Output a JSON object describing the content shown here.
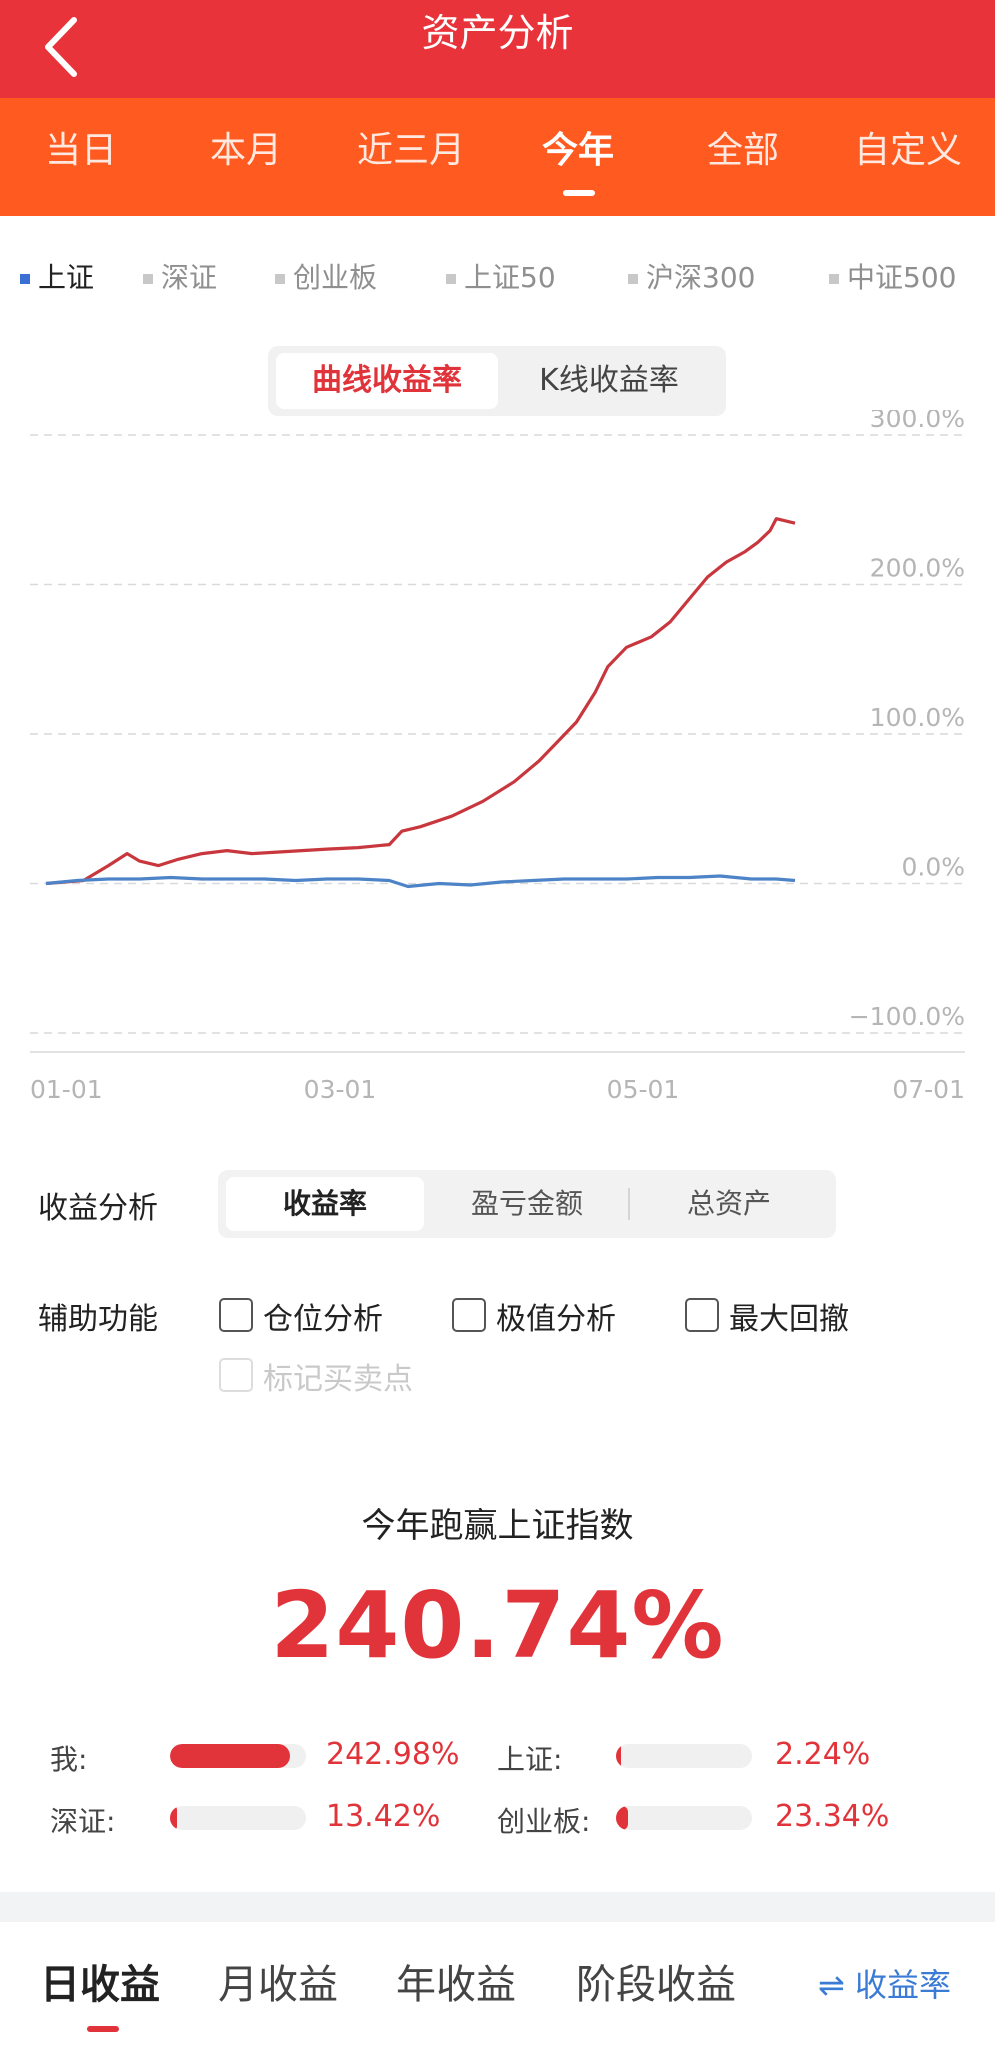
{
  "header": {
    "title": "资产分析",
    "bg": "#e8333a"
  },
  "period_tabs": {
    "items": [
      "当日",
      "本月",
      "近三月",
      "今年",
      "全部",
      "自定义"
    ],
    "active": "今年",
    "bg": "#ff5a1f"
  },
  "indices": {
    "items": [
      "上证",
      "深证",
      "创业板",
      "上证50",
      "沪深300",
      "中证500"
    ],
    "active": "上证"
  },
  "chart_toggle": {
    "curve": "曲线收益率",
    "kline": "K线收益率",
    "active": "曲线收益率"
  },
  "chart_data": {
    "type": "line",
    "ylim": [
      -100,
      300
    ],
    "y_ticks": [
      "300.0%",
      "200.0%",
      "100.0%",
      "0.0%",
      "−100.0%"
    ],
    "x_ticks": [
      "01-01",
      "03-01",
      "05-01",
      "07-01"
    ],
    "grid": "dashed horizontal",
    "series": [
      {
        "color": "#c8373d",
        "points": [
          [
            0,
            0
          ],
          [
            12,
            2
          ],
          [
            20,
            12
          ],
          [
            26,
            20
          ],
          [
            30,
            15
          ],
          [
            36,
            12
          ],
          [
            42,
            16
          ],
          [
            50,
            20
          ],
          [
            58,
            22
          ],
          [
            66,
            20
          ],
          [
            74,
            21
          ],
          [
            82,
            22
          ],
          [
            90,
            23
          ],
          [
            100,
            24
          ],
          [
            110,
            26
          ],
          [
            114,
            35
          ],
          [
            120,
            38
          ],
          [
            130,
            45
          ],
          [
            140,
            55
          ],
          [
            150,
            68
          ],
          [
            158,
            82
          ],
          [
            164,
            95
          ],
          [
            170,
            108
          ],
          [
            176,
            128
          ],
          [
            180,
            145
          ],
          [
            186,
            158
          ],
          [
            194,
            165
          ],
          [
            200,
            175
          ],
          [
            206,
            190
          ],
          [
            212,
            205
          ],
          [
            218,
            215
          ],
          [
            224,
            222
          ],
          [
            228,
            228
          ],
          [
            232,
            236
          ],
          [
            234,
            244
          ],
          [
            240,
            241
          ]
        ]
      },
      {
        "color": "#4d84c7",
        "points": [
          [
            0,
            0
          ],
          [
            10,
            2
          ],
          [
            20,
            3
          ],
          [
            30,
            3
          ],
          [
            40,
            4
          ],
          [
            50,
            3
          ],
          [
            60,
            3
          ],
          [
            70,
            3
          ],
          [
            80,
            2
          ],
          [
            90,
            3
          ],
          [
            100,
            3
          ],
          [
            110,
            2
          ],
          [
            116,
            -2
          ],
          [
            126,
            0
          ],
          [
            136,
            -1
          ],
          [
            146,
            1
          ],
          [
            156,
            2
          ],
          [
            166,
            3
          ],
          [
            176,
            3
          ],
          [
            186,
            3
          ],
          [
            196,
            4
          ],
          [
            206,
            4
          ],
          [
            216,
            5
          ],
          [
            226,
            3
          ],
          [
            234,
            3
          ],
          [
            240,
            2
          ]
        ]
      }
    ]
  },
  "analysis": {
    "label": "收益分析",
    "segments": [
      "收益率",
      "盈亏金额",
      "总资产"
    ],
    "active": "收益率"
  },
  "assist": {
    "label": "辅助功能",
    "options": [
      "仓位分析",
      "极值分析",
      "最大回撤",
      "标记买卖点"
    ],
    "disabled": "标记买卖点"
  },
  "summary": {
    "title": "今年跑赢上证指数",
    "value": "240.74%"
  },
  "comparison": [
    {
      "label": "我:",
      "value": "242.98%",
      "fraction": 0.88
    },
    {
      "label": "上证:",
      "value": "2.24%",
      "fraction": 0.01
    },
    {
      "label": "深证:",
      "value": "13.42%",
      "fraction": 0.05
    },
    {
      "label": "创业板:",
      "value": "23.34%",
      "fraction": 0.09
    }
  ],
  "bottom_tabs": {
    "items": [
      "日收益",
      "月收益",
      "年收益",
      "阶段收益"
    ],
    "active": "日收益",
    "rate_link": "⇌ 收益率"
  },
  "colors": {
    "accent": "#e1333a",
    "link": "#3a7bd5"
  }
}
